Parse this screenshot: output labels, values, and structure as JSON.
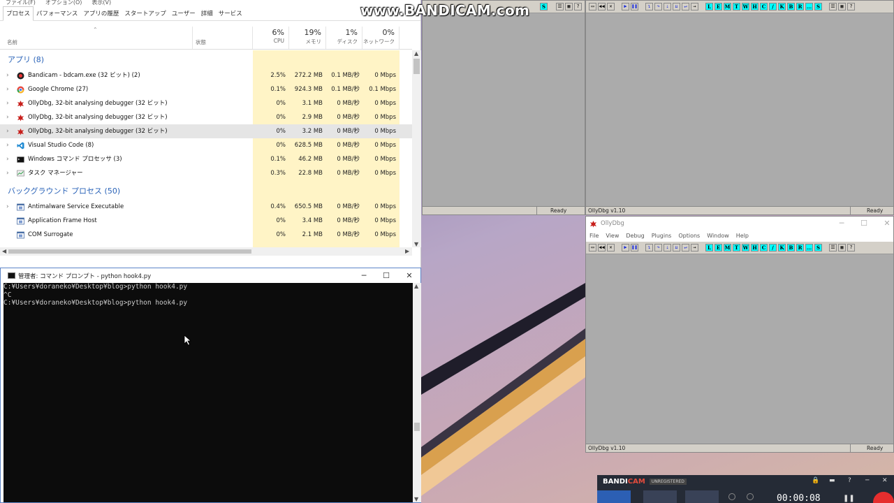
{
  "taskmgr": {
    "menu": [
      "ファイル(F)",
      "オプション(O)",
      "表示(V)"
    ],
    "tabs": [
      "プロセス",
      "パフォーマンス",
      "アプリの履歴",
      "スタートアップ",
      "ユーザー",
      "詳細",
      "サービス"
    ],
    "columns": {
      "name": "名前",
      "status": "状態",
      "cpu_pct": "6%",
      "cpu": "CPU",
      "mem_pct": "19%",
      "mem": "メモリ",
      "disk_pct": "1%",
      "disk": "ディスク",
      "net_pct": "0%",
      "net": "ネットワーク"
    },
    "group_apps": "アプリ (8)",
    "group_bg": "バックグラウンド プロセス (50)",
    "apps": [
      {
        "name": "Bandicam - bdcam.exe (32 ビット) (2)",
        "cpu": "2.5%",
        "mem": "272.2 MB",
        "disk": "0.1 MB/秒",
        "net": "0 Mbps"
      },
      {
        "name": "Google Chrome (27)",
        "cpu": "0.1%",
        "mem": "924.3 MB",
        "disk": "0.1 MB/秒",
        "net": "0.1 Mbps"
      },
      {
        "name": "OllyDbg, 32-bit analysing debugger (32 ビット)",
        "cpu": "0%",
        "mem": "3.1 MB",
        "disk": "0 MB/秒",
        "net": "0 Mbps"
      },
      {
        "name": "OllyDbg, 32-bit analysing debugger (32 ビット)",
        "cpu": "0%",
        "mem": "2.9 MB",
        "disk": "0 MB/秒",
        "net": "0 Mbps"
      },
      {
        "name": "OllyDbg, 32-bit analysing debugger (32 ビット)",
        "cpu": "0%",
        "mem": "3.2 MB",
        "disk": "0 MB/秒",
        "net": "0 Mbps"
      },
      {
        "name": "Visual Studio Code (8)",
        "cpu": "0%",
        "mem": "628.5 MB",
        "disk": "0 MB/秒",
        "net": "0 Mbps"
      },
      {
        "name": "Windows コマンド プロセッサ (3)",
        "cpu": "0.1%",
        "mem": "46.2 MB",
        "disk": "0 MB/秒",
        "net": "0 Mbps"
      },
      {
        "name": "タスク マネージャー",
        "cpu": "0.3%",
        "mem": "22.8 MB",
        "disk": "0 MB/秒",
        "net": "0 Mbps"
      }
    ],
    "bg": [
      {
        "name": "Antimalware Service Executable",
        "cpu": "0.4%",
        "mem": "650.5 MB",
        "disk": "0 MB/秒",
        "net": "0 Mbps"
      },
      {
        "name": "Application Frame Host",
        "cpu": "0%",
        "mem": "3.4 MB",
        "disk": "0 MB/秒",
        "net": "0 Mbps"
      },
      {
        "name": "COM Surrogate",
        "cpu": "0%",
        "mem": "2.1 MB",
        "disk": "0 MB/秒",
        "net": "0 Mbps"
      }
    ]
  },
  "cmd": {
    "title": "管理者: コマンド プロンプト - python  hook4.py",
    "lines": [
      "C:¥Users¥doraneko¥Desktop¥blog>python hook4.py",
      "^C",
      "C:¥Users¥doraneko¥Desktop¥blog>python hook4.py"
    ]
  },
  "olly": {
    "title": "OllyDbg",
    "menu": [
      "File",
      "View",
      "Debug",
      "Plugins",
      "Options",
      "Window",
      "Help"
    ],
    "version": "OllyDbg v1.10",
    "ready": "Ready",
    "letter_buttons": [
      "L",
      "E",
      "M",
      "T",
      "W",
      "H",
      "C",
      "/",
      "K",
      "B",
      "R",
      "...",
      "S"
    ]
  },
  "bandicam": {
    "watermark": "www.BANDICAM.com",
    "logo_a": "BANDI",
    "logo_b": "CAM",
    "unregistered": "UNREGISTERED",
    "timer": "00:00:08"
  }
}
